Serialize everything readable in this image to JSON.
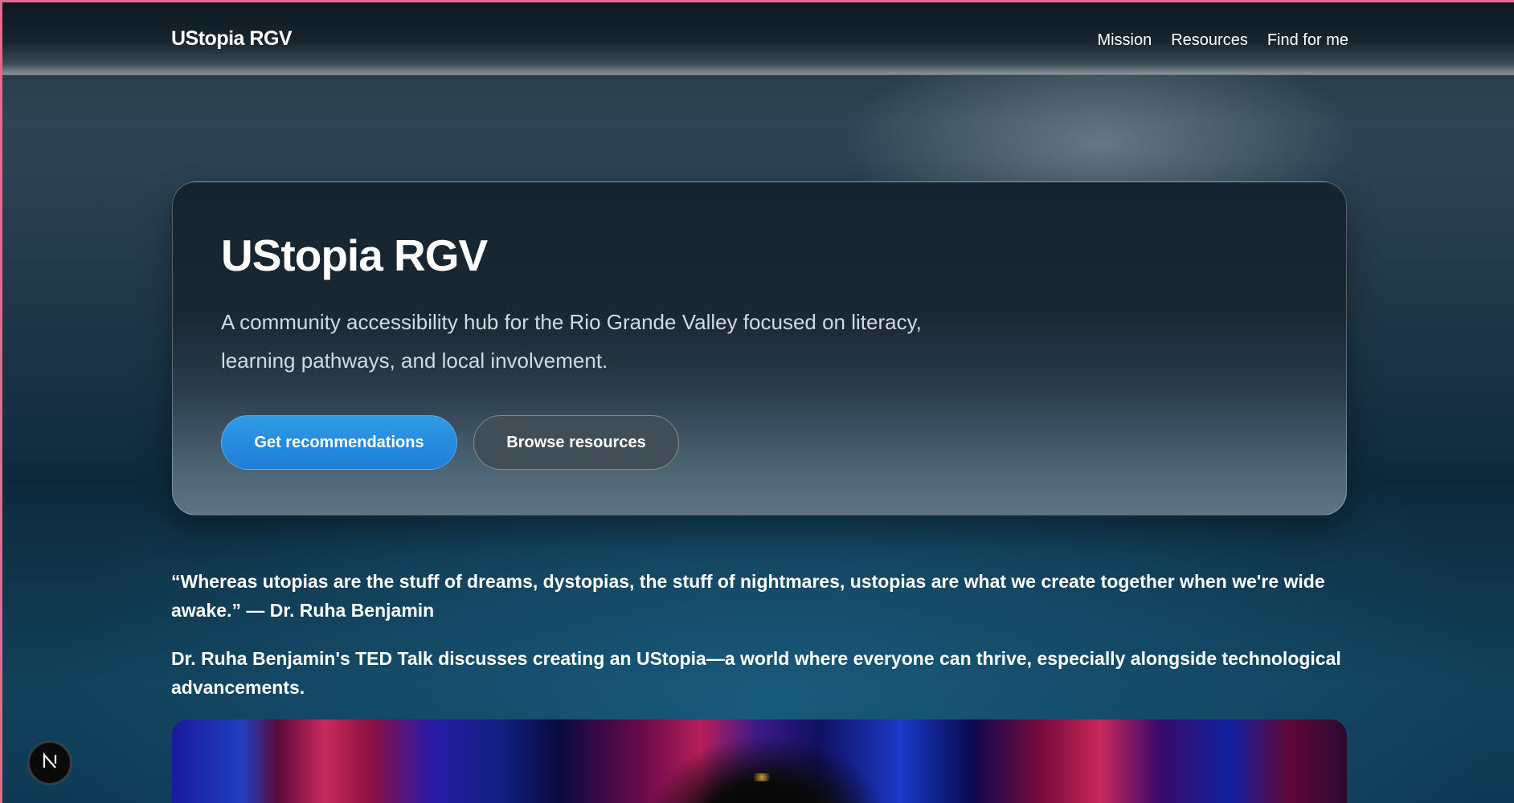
{
  "header": {
    "brand": "UStopia RGV",
    "nav": [
      {
        "label": "Mission"
      },
      {
        "label": "Resources"
      },
      {
        "label": "Find for me"
      }
    ]
  },
  "hero": {
    "title": "UStopia RGV",
    "description": "A community accessibility hub for the Rio Grande Valley focused on literacy, learning pathways, and local involvement.",
    "primary_button": "Get recommendations",
    "secondary_button": "Browse resources"
  },
  "content": {
    "quote": "“Whereas utopias are the stuff of dreams, dystopias, the stuff of nightmares, ustopias are what we create together when we're wide awake.” — Dr. Ruha Benjamin",
    "description": "Dr. Ruha Benjamin's TED Talk discusses creating an UStopia—a world where everyone can thrive, especially alongside technological advancements."
  },
  "dev_badge": {
    "icon": "nextjs-logo-icon"
  },
  "colors": {
    "primary_button": "#1e7fd6",
    "secondary_button": "#414d57",
    "frame_border": "#e26a92"
  }
}
